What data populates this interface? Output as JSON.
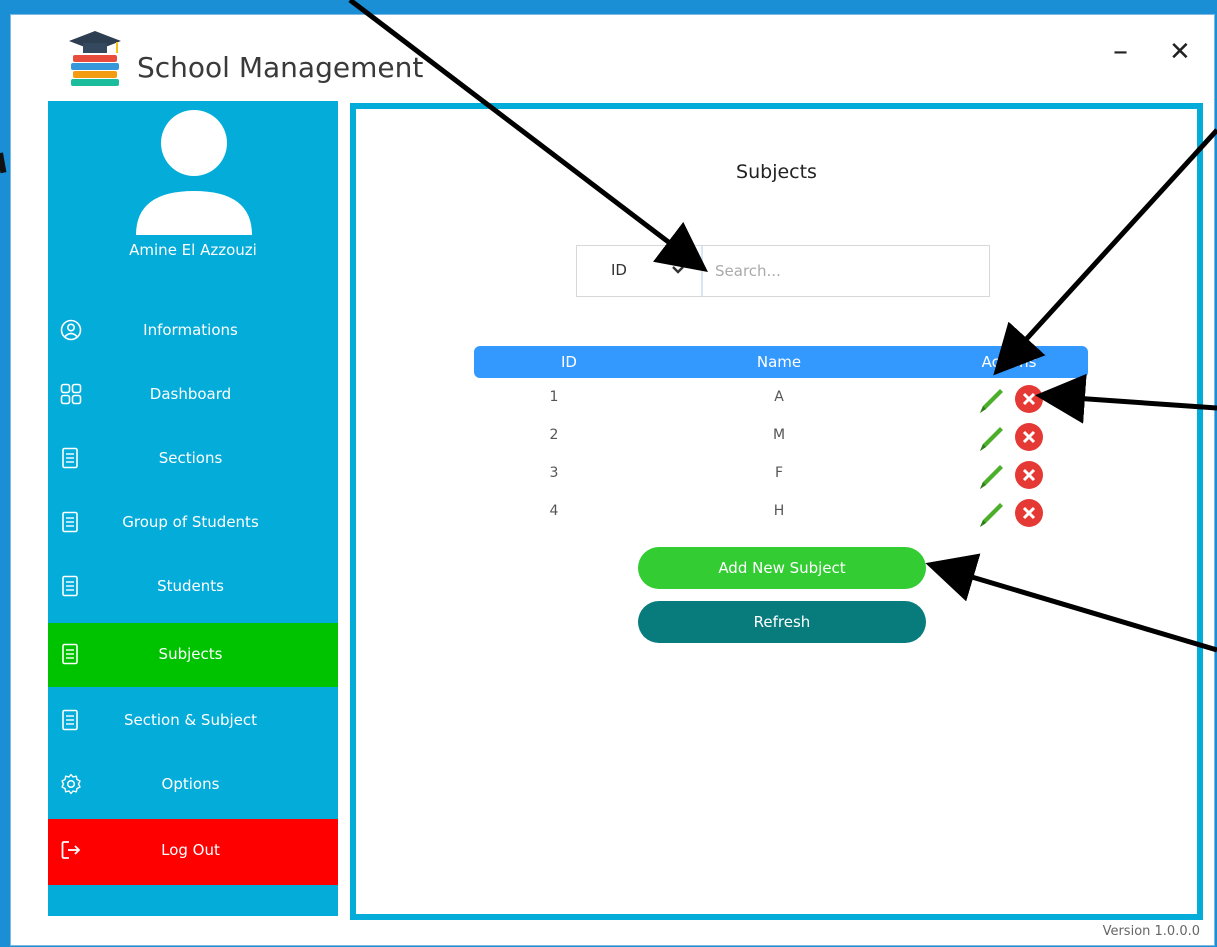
{
  "app": {
    "title": "School Management"
  },
  "window_controls": {
    "minimize": "–",
    "close": "✕"
  },
  "user": {
    "name": "Amine El Azzouzi"
  },
  "sidebar": {
    "items": [
      {
        "label": "Informations",
        "icon": "user-circle-icon"
      },
      {
        "label": "Dashboard",
        "icon": "dashboard-grid-icon"
      },
      {
        "label": "Sections",
        "icon": "document-icon"
      },
      {
        "label": "Group of Students",
        "icon": "document-icon"
      },
      {
        "label": "Students",
        "icon": "document-icon"
      },
      {
        "label": "Subjects",
        "icon": "document-icon",
        "active": true
      },
      {
        "label": "Section & Subject",
        "icon": "document-icon"
      },
      {
        "label": "Options",
        "icon": "gear-icon"
      },
      {
        "label": "Log Out",
        "icon": "logout-icon"
      }
    ]
  },
  "main": {
    "page_title": "Subjects",
    "search": {
      "filter_selected": "ID",
      "placeholder": "Search..."
    },
    "table": {
      "headers": [
        "ID",
        "Name",
        "Actions"
      ],
      "rows": [
        {
          "id": "1",
          "name": "A"
        },
        {
          "id": "2",
          "name": "M"
        },
        {
          "id": "3",
          "name": "F"
        },
        {
          "id": "4",
          "name": "H"
        }
      ]
    },
    "buttons": {
      "add": "Add New Subject",
      "refresh": "Refresh"
    }
  },
  "footer": {
    "version": "Version 1.0.0.0"
  },
  "colors": {
    "sidebar": "#03acd9",
    "active": "#00c300",
    "logout": "#ff0000",
    "header": "#3399ff",
    "add": "#33cc33",
    "refresh": "#087c7c"
  }
}
